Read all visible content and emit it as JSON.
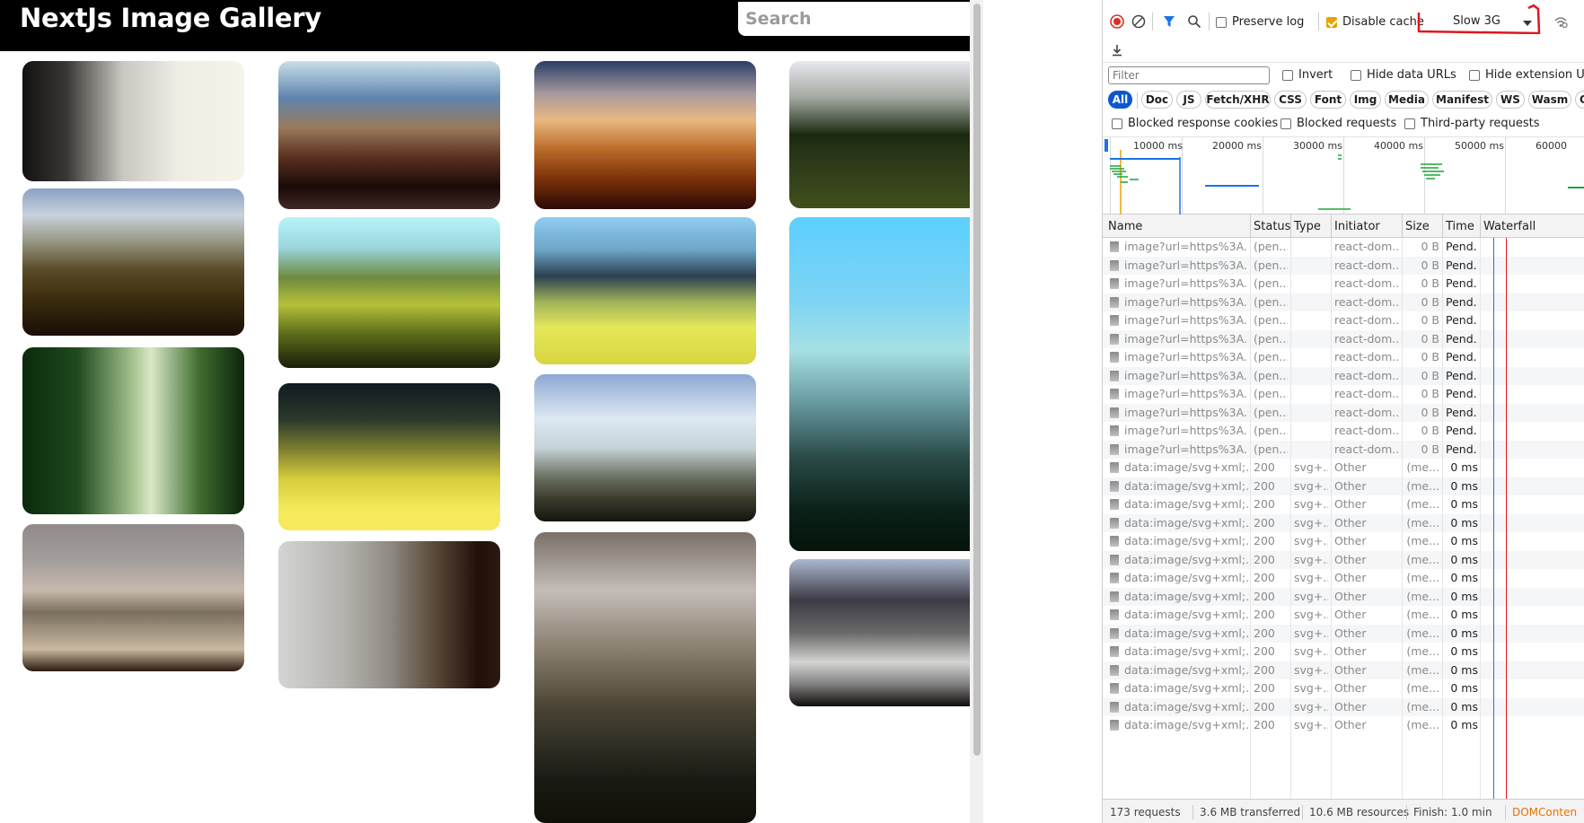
{
  "gallery": {
    "title": "NextJs Image Gallery",
    "search_placeholder": "Search"
  },
  "devtools": {
    "toolbar": {
      "preserve_log_label": "Preserve log",
      "preserve_log_checked": false,
      "disable_cache_label": "Disable cache",
      "disable_cache_checked": true,
      "throttle_value": "Slow 3G"
    },
    "filter": {
      "placeholder": "Filter",
      "invert_label": "Invert",
      "hide_data_urls_label": "Hide data URLs",
      "hide_extension_urls_label": "Hide extension URL"
    },
    "type_filters": [
      "All",
      "Doc",
      "JS",
      "Fetch/XHR",
      "CSS",
      "Font",
      "Img",
      "Media",
      "Manifest",
      "WS",
      "Wasm",
      "Oth"
    ],
    "active_type_filter": "All",
    "blocked": {
      "blocked_response_cookies": "Blocked response cookies",
      "blocked_requests": "Blocked requests",
      "third_party_requests": "Third-party requests"
    },
    "overview_ticks": [
      "10000 ms",
      "20000 ms",
      "30000 ms",
      "40000 ms",
      "50000 ms",
      "60000"
    ],
    "columns": {
      "name": "Name",
      "status": "Status",
      "type": "Type",
      "initiator": "Initiator",
      "size": "Size",
      "time": "Time",
      "waterfall": "Waterfall"
    },
    "requests": [
      {
        "name": "image?url=https%3A...",
        "status": "(pen...",
        "type": "",
        "initiator": "react-dom...",
        "size": "0 B",
        "time": "Pend..."
      },
      {
        "name": "image?url=https%3A...",
        "status": "(pen...",
        "type": "",
        "initiator": "react-dom...",
        "size": "0 B",
        "time": "Pend..."
      },
      {
        "name": "image?url=https%3A...",
        "status": "(pen...",
        "type": "",
        "initiator": "react-dom...",
        "size": "0 B",
        "time": "Pend..."
      },
      {
        "name": "image?url=https%3A...",
        "status": "(pen...",
        "type": "",
        "initiator": "react-dom...",
        "size": "0 B",
        "time": "Pend..."
      },
      {
        "name": "image?url=https%3A...",
        "status": "(pen...",
        "type": "",
        "initiator": "react-dom...",
        "size": "0 B",
        "time": "Pend..."
      },
      {
        "name": "image?url=https%3A...",
        "status": "(pen...",
        "type": "",
        "initiator": "react-dom...",
        "size": "0 B",
        "time": "Pend..."
      },
      {
        "name": "image?url=https%3A...",
        "status": "(pen...",
        "type": "",
        "initiator": "react-dom...",
        "size": "0 B",
        "time": "Pend..."
      },
      {
        "name": "image?url=https%3A...",
        "status": "(pen...",
        "type": "",
        "initiator": "react-dom...",
        "size": "0 B",
        "time": "Pend..."
      },
      {
        "name": "image?url=https%3A...",
        "status": "(pen...",
        "type": "",
        "initiator": "react-dom...",
        "size": "0 B",
        "time": "Pend..."
      },
      {
        "name": "image?url=https%3A...",
        "status": "(pen...",
        "type": "",
        "initiator": "react-dom...",
        "size": "0 B",
        "time": "Pend..."
      },
      {
        "name": "image?url=https%3A...",
        "status": "(pen...",
        "type": "",
        "initiator": "react-dom...",
        "size": "0 B",
        "time": "Pend..."
      },
      {
        "name": "image?url=https%3A...",
        "status": "(pen...",
        "type": "",
        "initiator": "react-dom...",
        "size": "0 B",
        "time": "Pend..."
      },
      {
        "name": "data:image/svg+xml;...",
        "status": "200",
        "type": "svg+...",
        "initiator": "Other",
        "size": "(me...",
        "time": "0 ms"
      },
      {
        "name": "data:image/svg+xml;...",
        "status": "200",
        "type": "svg+...",
        "initiator": "Other",
        "size": "(me...",
        "time": "0 ms"
      },
      {
        "name": "data:image/svg+xml;...",
        "status": "200",
        "type": "svg+...",
        "initiator": "Other",
        "size": "(me...",
        "time": "0 ms"
      },
      {
        "name": "data:image/svg+xml;...",
        "status": "200",
        "type": "svg+...",
        "initiator": "Other",
        "size": "(me...",
        "time": "0 ms"
      },
      {
        "name": "data:image/svg+xml;...",
        "status": "200",
        "type": "svg+...",
        "initiator": "Other",
        "size": "(me...",
        "time": "0 ms"
      },
      {
        "name": "data:image/svg+xml;...",
        "status": "200",
        "type": "svg+...",
        "initiator": "Other",
        "size": "(me...",
        "time": "0 ms"
      },
      {
        "name": "data:image/svg+xml;...",
        "status": "200",
        "type": "svg+...",
        "initiator": "Other",
        "size": "(me...",
        "time": "0 ms"
      },
      {
        "name": "data:image/svg+xml;...",
        "status": "200",
        "type": "svg+...",
        "initiator": "Other",
        "size": "(me...",
        "time": "0 ms"
      },
      {
        "name": "data:image/svg+xml;...",
        "status": "200",
        "type": "svg+...",
        "initiator": "Other",
        "size": "(me...",
        "time": "0 ms"
      },
      {
        "name": "data:image/svg+xml;...",
        "status": "200",
        "type": "svg+...",
        "initiator": "Other",
        "size": "(me...",
        "time": "0 ms"
      },
      {
        "name": "data:image/svg+xml;...",
        "status": "200",
        "type": "svg+...",
        "initiator": "Other",
        "size": "(me...",
        "time": "0 ms"
      },
      {
        "name": "data:image/svg+xml;...",
        "status": "200",
        "type": "svg+...",
        "initiator": "Other",
        "size": "(me...",
        "time": "0 ms"
      },
      {
        "name": "data:image/svg+xml;...",
        "status": "200",
        "type": "svg+...",
        "initiator": "Other",
        "size": "(me...",
        "time": "0 ms"
      },
      {
        "name": "data:image/svg+xml;...",
        "status": "200",
        "type": "svg+...",
        "initiator": "Other",
        "size": "(me...",
        "time": "0 ms"
      },
      {
        "name": "data:image/svg+xml;...",
        "status": "200",
        "type": "svg+...",
        "initiator": "Other",
        "size": "(me...",
        "time": "0 ms"
      }
    ],
    "status_bar": {
      "requests": "173 requests",
      "transferred": "3.6 MB transferred",
      "resources": "10.6 MB resources",
      "finish": "Finish: 1.0 min",
      "domcontent": "DOMConten"
    },
    "colors": {
      "active_filter": "#0b57d0",
      "checkbox_checked": "#e8a200",
      "record_stop": "#d93025",
      "annotation": "#e0161e"
    }
  }
}
